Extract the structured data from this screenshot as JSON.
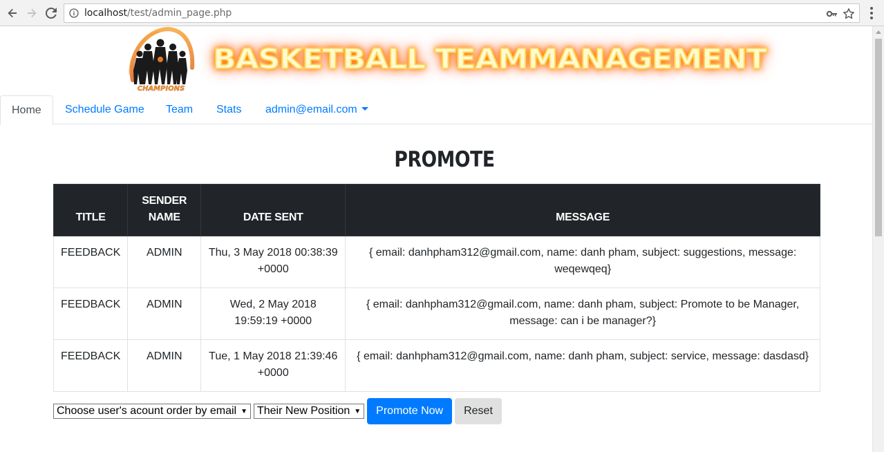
{
  "browser": {
    "url_host": "localhost",
    "url_path": "/test/admin_page.php"
  },
  "banner": {
    "title": "BASKETBALL TEAMMANAGEMENT",
    "logo_text": "CHAMPIONS"
  },
  "nav": {
    "tabs": [
      {
        "label": "Home",
        "active": true
      },
      {
        "label": "Schedule Game"
      },
      {
        "label": "Team"
      },
      {
        "label": "Stats"
      },
      {
        "label": "admin@email.com"
      }
    ]
  },
  "main": {
    "heading": "PROMOTE",
    "table": {
      "headers": [
        "TITLE",
        "SENDER NAME",
        "DATE SENT",
        "MESSAGE"
      ],
      "rows": [
        {
          "title": "FEEDBACK",
          "sender": "ADMIN",
          "date": "Thu, 3 May 2018 00:38:39 +0000",
          "message": "{ email: danhpham312@gmail.com, name: danh pham, subject: suggestions, message: weqewqeq}"
        },
        {
          "title": "FEEDBACK",
          "sender": "ADMIN",
          "date": "Wed, 2 May 2018 19:59:19 +0000",
          "message": "{ email: danhpham312@gmail.com, name: danh pham, subject: Promote to be Manager, message: can i be manager?}"
        },
        {
          "title": "FEEDBACK",
          "sender": "ADMIN",
          "date": "Tue, 1 May 2018 21:39:46 +0000",
          "message": "{ email: danhpham312@gmail.com, name: danh pham, subject: service, message: dasdasd}"
        }
      ]
    },
    "form": {
      "user_select": "Choose user's acount order by email",
      "position_select": "Their New Position",
      "promote_button": "Promote Now",
      "reset_button": "Reset"
    }
  },
  "colors": {
    "primary": "#007bff",
    "table_header": "#212529",
    "brand_glow": "#ff6a00"
  }
}
